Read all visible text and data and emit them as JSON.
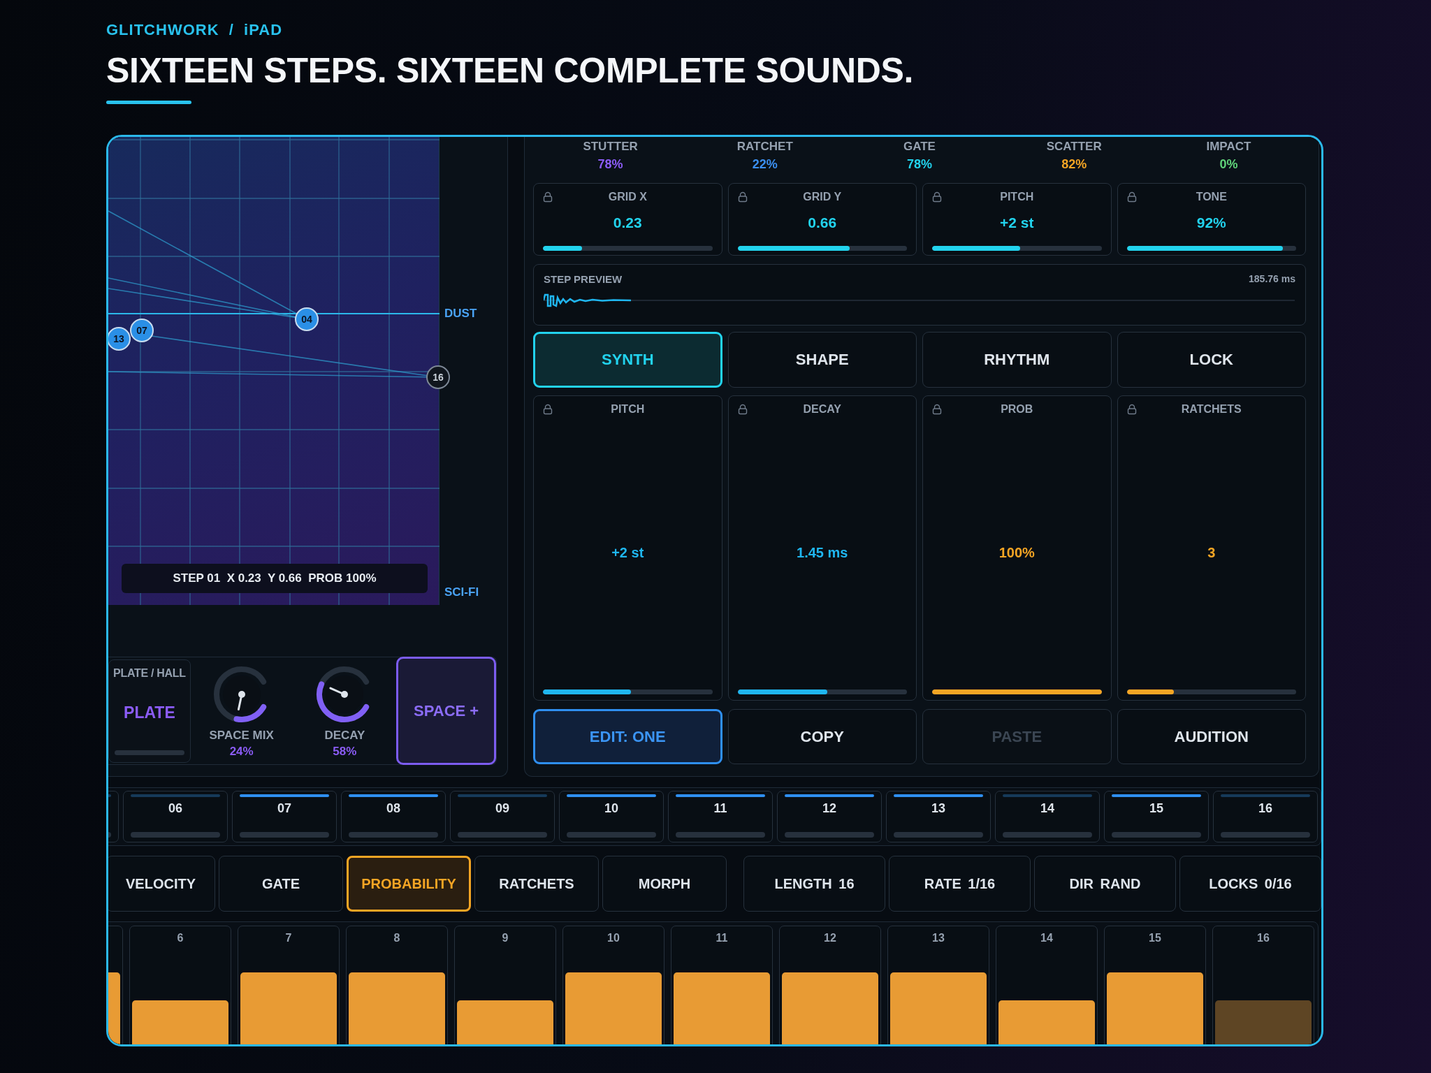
{
  "header": {
    "brand": "GLITCHWORK  /  iPAD",
    "headline": "SIXTEEN STEPS. SIXTEEN COMPLETE SOUNDS."
  },
  "xy_pad": {
    "nodes": [
      {
        "label": "04",
        "active": true
      },
      {
        "label": "07",
        "active": true
      },
      {
        "label": "13",
        "active": true
      },
      {
        "label": "16",
        "active": false
      }
    ],
    "axis_labels": [
      "DUST",
      "SCI-FI"
    ],
    "readout": "STEP 01  X 0.23  Y 0.66  PROB 100%"
  },
  "space": {
    "mode": {
      "label": "PLATE / HALL",
      "value": "PLATE"
    },
    "knobs": [
      {
        "label": "SPACE MIX",
        "reading": "24%"
      },
      {
        "label": "DECAY",
        "reading": "58%"
      }
    ],
    "button": "SPACE +"
  },
  "macros": [
    {
      "label": "STUTTER",
      "value": "78%",
      "color": "#8b5cf6"
    },
    {
      "label": "RATCHET",
      "value": "22%",
      "color": "#3b8ff0"
    },
    {
      "label": "GATE",
      "value": "78%",
      "color": "#22d3ee"
    },
    {
      "label": "SCATTER",
      "value": "82%",
      "color": "#f5a524"
    },
    {
      "label": "IMPACT",
      "value": "0%",
      "color": "#5fd37a"
    }
  ],
  "params": [
    {
      "label": "GRID X",
      "value": "0.23",
      "level": 0.23
    },
    {
      "label": "GRID Y",
      "value": "0.66",
      "level": 0.66
    },
    {
      "label": "PITCH",
      "value": "+2 st",
      "level": 0.52
    },
    {
      "label": "TONE",
      "value": "92%",
      "level": 0.92
    }
  ],
  "step_preview": {
    "label": "STEP PREVIEW",
    "duration": "185.76 ms"
  },
  "tabs": [
    {
      "label": "SYNTH",
      "selected": true
    },
    {
      "label": "SHAPE",
      "selected": false
    },
    {
      "label": "RHYTHM",
      "selected": false
    },
    {
      "label": "LOCK",
      "selected": false
    }
  ],
  "controls": [
    {
      "label": "PITCH",
      "value": "+2 st",
      "level": 0.52,
      "color": "#1fb6f0"
    },
    {
      "label": "DECAY",
      "value": "1.45 ms",
      "level": 0.53,
      "color": "#1fb6f0"
    },
    {
      "label": "PROB",
      "value": "100%",
      "level": 1,
      "color": "#f5a524"
    },
    {
      "label": "RATCHETS",
      "value": "3",
      "level": 0.28,
      "color": "#f5a524"
    }
  ],
  "actions": [
    {
      "label": "EDIT: ONE",
      "selected": true,
      "disabled": false
    },
    {
      "label": "COPY",
      "selected": false,
      "disabled": false
    },
    {
      "label": "PASTE",
      "selected": false,
      "disabled": true
    },
    {
      "label": "AUDITION",
      "selected": false,
      "disabled": false
    }
  ],
  "steps": [
    {
      "active": false
    },
    {
      "label": "06",
      "active": false
    },
    {
      "label": "07",
      "active": true
    },
    {
      "label": "08",
      "active": true
    },
    {
      "label": "09",
      "active": false
    },
    {
      "label": "10",
      "active": true
    },
    {
      "label": "11",
      "active": true
    },
    {
      "label": "12",
      "active": true
    },
    {
      "label": "13",
      "active": true
    },
    {
      "label": "14",
      "active": false
    },
    {
      "label": "15",
      "active": true
    },
    {
      "label": "16",
      "active": false
    }
  ],
  "lanes": [
    {
      "label": "VELOCITY",
      "selected": false
    },
    {
      "label": "GATE",
      "selected": false
    },
    {
      "label": "PROBABILITY",
      "selected": true
    },
    {
      "label": "RATCHETS",
      "selected": false
    },
    {
      "label": "MORPH",
      "selected": false
    }
  ],
  "settings": [
    "LENGTH 16",
    "RATE 1/16",
    "DIR RAND",
    "LOCKS 0/16"
  ],
  "bars": [
    {
      "muted": false
    },
    {
      "label": "6",
      "muted": false
    },
    {
      "label": "7",
      "muted": false
    },
    {
      "label": "8",
      "muted": false
    },
    {
      "label": "9",
      "muted": false
    },
    {
      "label": "10",
      "muted": false
    },
    {
      "label": "11",
      "muted": false
    },
    {
      "label": "12",
      "muted": false
    },
    {
      "label": "13",
      "muted": false
    },
    {
      "label": "14",
      "muted": false
    },
    {
      "label": "15",
      "muted": false
    },
    {
      "label": "16",
      "muted": true
    }
  ]
}
